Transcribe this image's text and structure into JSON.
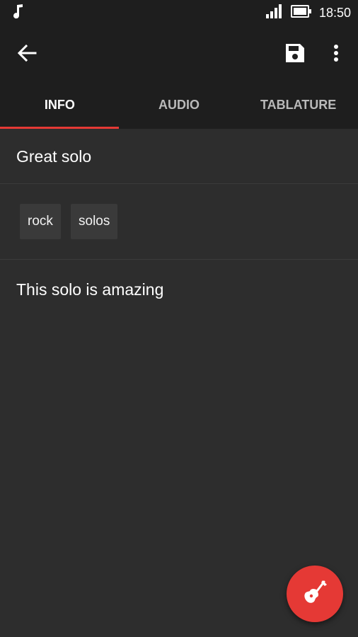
{
  "status_bar": {
    "time": "18:50",
    "icons": [
      "music-note-icon",
      "signal-icon",
      "battery-icon"
    ]
  },
  "app_bar": {
    "icons": [
      "back-arrow-icon",
      "save-icon",
      "more-vert-icon"
    ]
  },
  "tabs": [
    {
      "label": "INFO",
      "active": true
    },
    {
      "label": "AUDIO",
      "active": false
    },
    {
      "label": "TABLATURE",
      "active": false
    }
  ],
  "content": {
    "title": "Great solo",
    "tags": [
      "rock",
      "solos"
    ],
    "description": "This solo is amazing"
  },
  "fab": {
    "icon": "guitar-icon",
    "color": "#e53935"
  },
  "colors": {
    "accent": "#e53935",
    "bar_background": "#1e1e1e",
    "content_background": "#2d2d2d"
  }
}
